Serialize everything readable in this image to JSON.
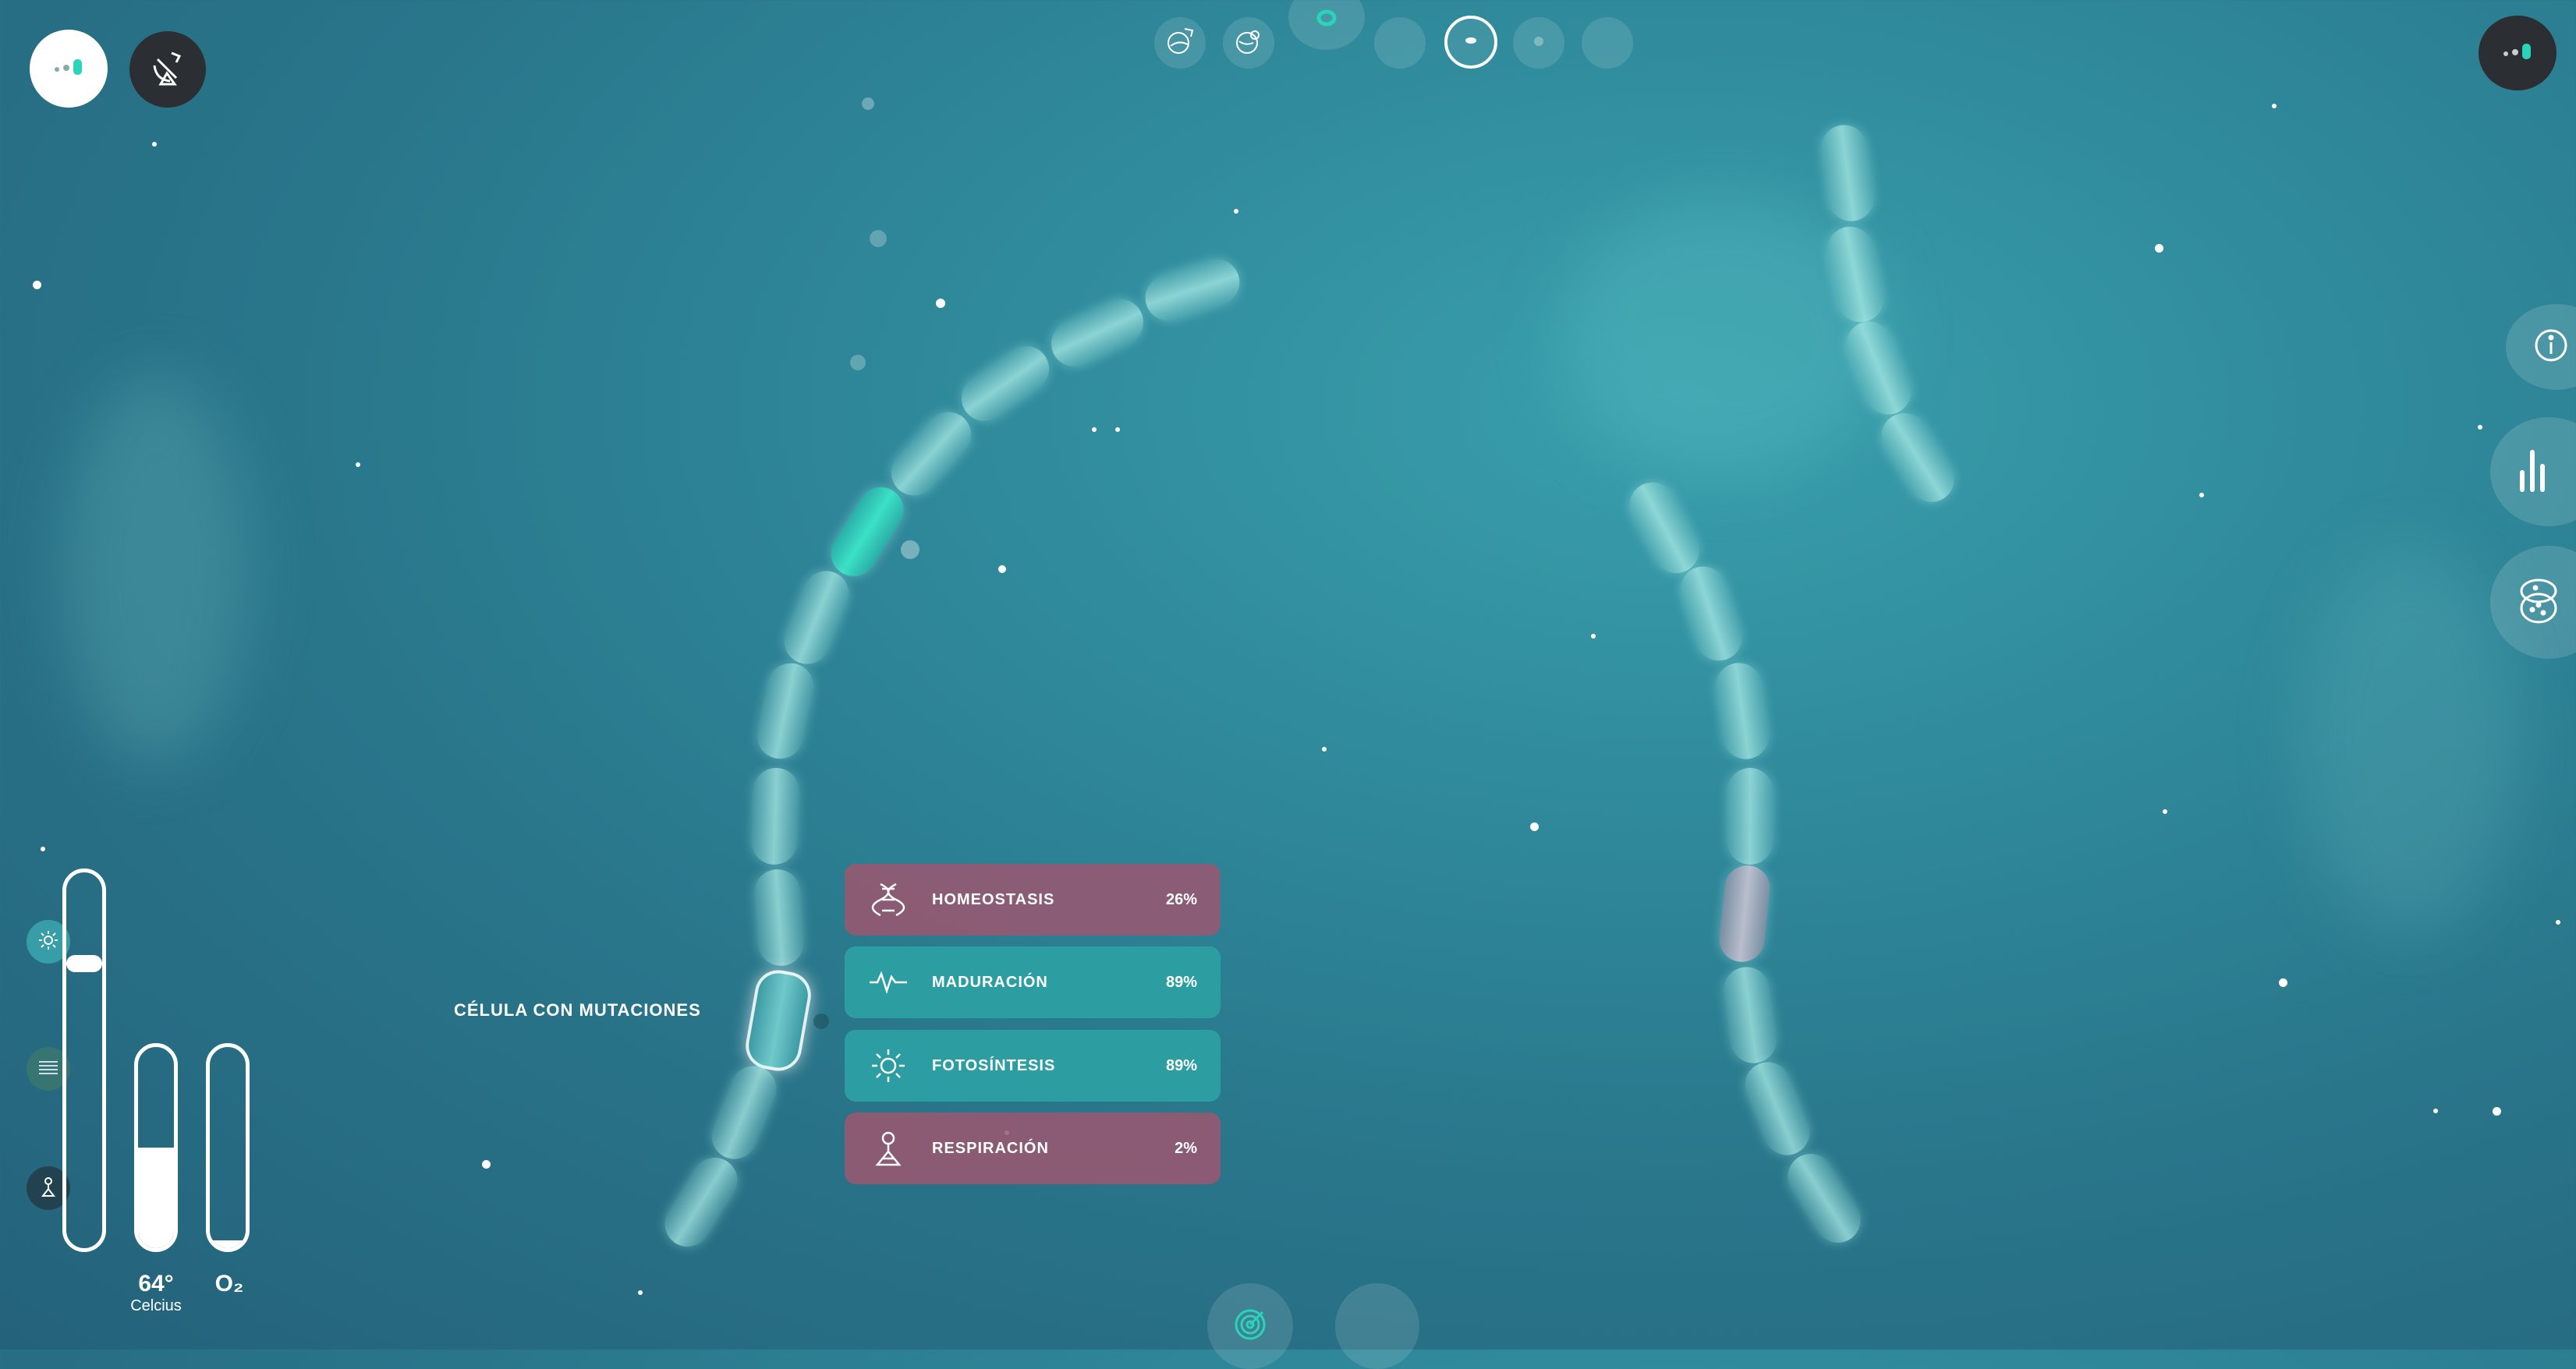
{
  "colors": {
    "accent": "#2ad4b8",
    "panel_dark": "#2b2f33",
    "stat_pink": "#9c5670",
    "stat_teal": "#2ca2a4"
  },
  "top_left": {
    "logo_icon": "signal-dots-icon",
    "satellite_icon": "satellite-dish-icon"
  },
  "top_right": {
    "logo_icon": "signal-dots-icon"
  },
  "top_nav": {
    "items": [
      {
        "icon": "planet-rocket-icon",
        "active": false
      },
      {
        "icon": "planet-search-icon",
        "active": false
      },
      {
        "icon": "ring-icon",
        "active": false
      },
      {
        "icon": "empty-icon",
        "active": false
      },
      {
        "icon": "cell-icon",
        "active": true
      },
      {
        "icon": "small-dot-icon",
        "active": false
      },
      {
        "icon": "empty-icon",
        "active": false
      }
    ]
  },
  "right_panel": {
    "buttons": [
      {
        "icon": "info-icon"
      },
      {
        "icon": "bar-chart-icon"
      },
      {
        "icon": "petri-dish-icon"
      }
    ]
  },
  "left_controls": {
    "toggles": [
      {
        "icon": "sun-icon",
        "active": true
      },
      {
        "icon": "menu-lines-icon",
        "active": false
      },
      {
        "icon": "flask-icon",
        "active": false
      }
    ],
    "light_slider_level": 0.22,
    "temperature": {
      "value": "64°",
      "unit": "Celcius",
      "level": 0.5
    },
    "oxygen": {
      "label": "O₂",
      "level": 0.04
    }
  },
  "cell_label": "CÉLULA CON MUTACIONES",
  "stats": [
    {
      "label": "HOMEOSTASIS",
      "value": "26%",
      "icon": "dna-icon",
      "tone": "pink"
    },
    {
      "label": "MADURACIÓN",
      "value": "89%",
      "icon": "pulse-icon",
      "tone": "teal"
    },
    {
      "label": "FOTOSÍNTESIS",
      "value": "89%",
      "icon": "sun-icon",
      "tone": "teal"
    },
    {
      "label": "RESPIRACIÓN",
      "value": "2%",
      "icon": "flask-icon",
      "tone": "pink"
    }
  ],
  "bottom": {
    "items": [
      {
        "icon": "target-icon"
      },
      {
        "icon": "empty-icon"
      }
    ]
  }
}
